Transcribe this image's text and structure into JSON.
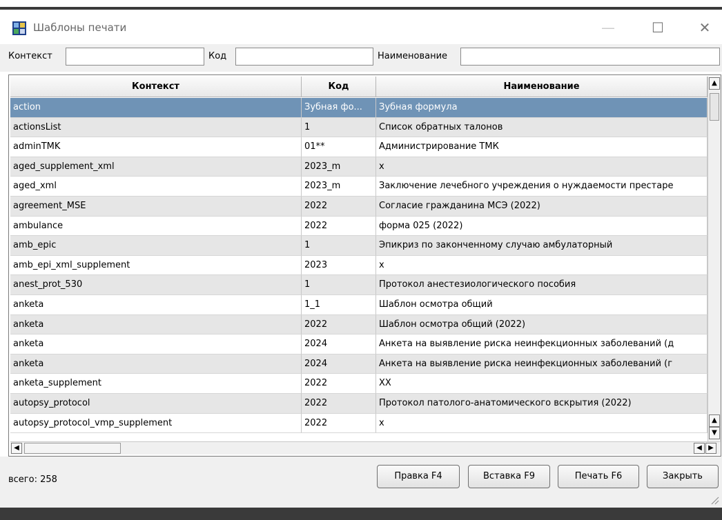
{
  "window": {
    "title": "Шаблоны печати",
    "minimize": "—",
    "maximize": "☐",
    "close": "✕"
  },
  "filters": {
    "context_label": "Контекст",
    "context_value": "",
    "code_label": "Код",
    "code_value": "",
    "name_label": "Наименование",
    "name_value": ""
  },
  "table": {
    "columns": [
      "Контекст",
      "Код",
      "Наименование"
    ],
    "rows": [
      {
        "context": "action",
        "code": "Зубная фо...",
        "name": "Зубная формула",
        "selected": true
      },
      {
        "context": "actionsList",
        "code": "1",
        "name": "Список обратных талонов"
      },
      {
        "context": "adminTMK",
        "code": "01**",
        "name": "Администрирование ТМК"
      },
      {
        "context": "aged_supplement_xml",
        "code": "2023_m",
        "name": "x"
      },
      {
        "context": "aged_xml",
        "code": "2023_m",
        "name": "Заключение лечебного учреждения о нуждаемости престаре"
      },
      {
        "context": "agreement_MSE",
        "code": "2022",
        "name": "Согласие гражданина МСЭ (2022)"
      },
      {
        "context": "ambulance",
        "code": "2022",
        "name": "форма 025 (2022)"
      },
      {
        "context": "amb_epic",
        "code": "1",
        "name": "Эпикриз по законченному случаю амбулаторный"
      },
      {
        "context": "amb_epi_xml_supplement",
        "code": "2023",
        "name": "x"
      },
      {
        "context": "anest_prot_530",
        "code": "1",
        "name": "Протокол анестезиологического пособия"
      },
      {
        "context": "anketa",
        "code": "1_1",
        "name": "Шаблон осмотра общий"
      },
      {
        "context": "anketa",
        "code": "2022",
        "name": "Шаблон осмотра общий (2022)"
      },
      {
        "context": "anketa",
        "code": "2024",
        "name": "Анкета на выявление риска неинфекционных заболеваний (д"
      },
      {
        "context": "anketa",
        "code": "2024",
        "name": "Анкета на выявление риска неинфекционных заболеваний (г"
      },
      {
        "context": "anketa_supplement",
        "code": "2022",
        "name": "XX"
      },
      {
        "context": "autopsy_protocol",
        "code": "2022",
        "name": "Протокол патолого-анатомического вскрытия (2022)"
      },
      {
        "context": "autopsy_protocol_vmp_supplement",
        "code": "2022",
        "name": "x"
      }
    ]
  },
  "footer": {
    "total": "всего: 258",
    "edit_button": "Правка F4",
    "insert_button": "Вставка F9",
    "print_button": "Печать F6",
    "close_button": "Закрыть"
  },
  "colors": {
    "selected_row": "#6f93b6",
    "alt_row": "#e6e6e6"
  }
}
